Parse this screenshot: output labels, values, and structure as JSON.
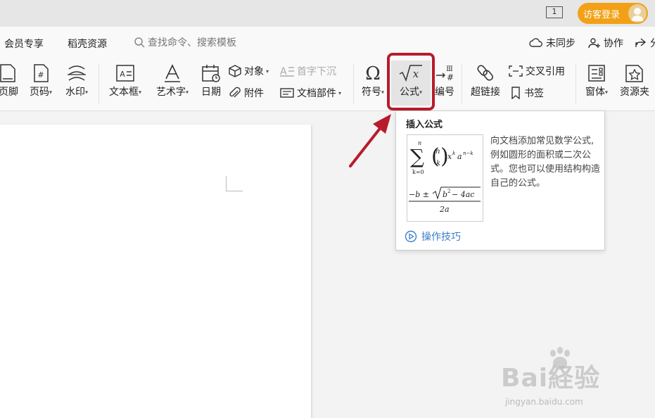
{
  "titlebar": {
    "window_badge": "1",
    "login_label": "访客登录"
  },
  "menubar": {
    "items": [
      "会员专享",
      "稻壳资源"
    ],
    "search_placeholder": "查找命令、搜索模板",
    "right": {
      "sync": "未同步",
      "collab": "协作",
      "share": "分"
    }
  },
  "ribbon": {
    "header_footer": "页脚",
    "page_number": "页码",
    "watermark": "水印",
    "textbox": "文本框",
    "wordart": "艺术字",
    "date": "日期",
    "object": "对象",
    "attachment": "附件",
    "drop_cap": "首字下沉",
    "doc_parts": "文档部件",
    "symbol": "符号",
    "formula": "公式",
    "numbering": "编号",
    "hyperlink": "超链接",
    "cross_ref": "交叉引用",
    "bookmark": "书签",
    "form": "窗体",
    "resource": "资源夹"
  },
  "tooltip": {
    "title": "插入公式",
    "description": "向文档添加常见数学公式, 例如圆形的面积或二次公式。您也可以使用结构构造自己的公式。",
    "link": "操作技巧",
    "formula_image": {
      "sum_top": "n",
      "sum_bottom": "k=0",
      "binom_top": "n",
      "binom_bottom": "k",
      "term": "x",
      "exp1": "k",
      "term2": "a",
      "exp2": "n−k",
      "quad_num_left": "−b ±",
      "quad_root": "b",
      "quad_root_exp": "2",
      "quad_root_rest": "− 4ac",
      "quad_den": "2a"
    }
  },
  "watermark": {
    "brand": "Bai経验",
    "url": "jingyan.baidu.com"
  },
  "colors": {
    "accent_orange": "#f2a117",
    "highlight_red": "#b71c2b",
    "link_blue": "#3b7ec9"
  }
}
